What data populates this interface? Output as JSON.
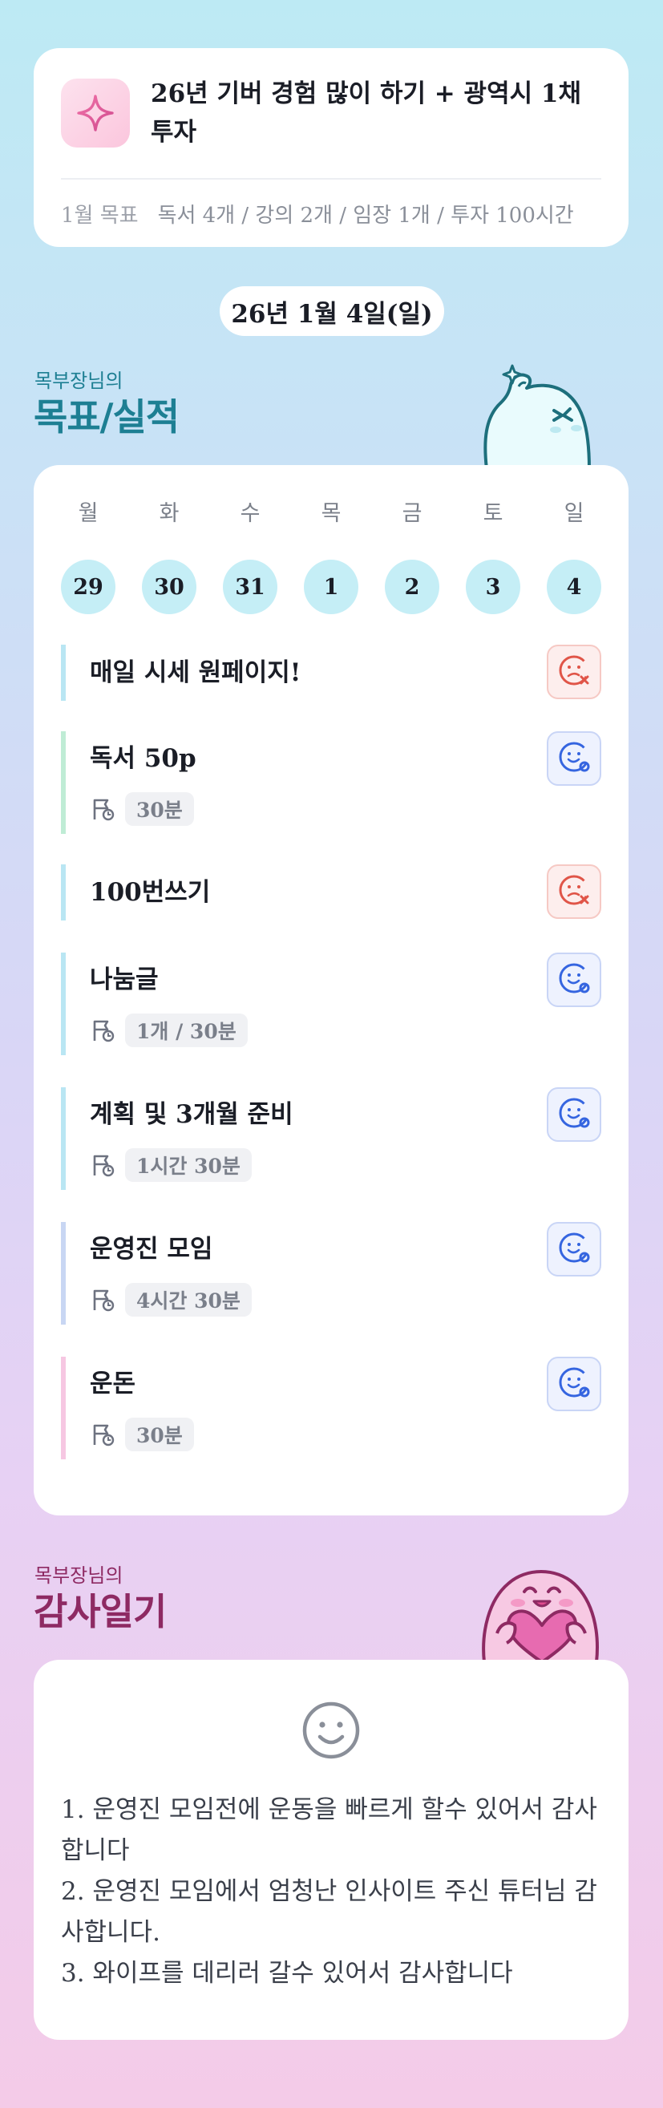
{
  "goal": {
    "icon": "sparkle-icon",
    "title": "26년 기버 경험 많이 하기 + 광역시 1채 투자",
    "month_label": "1월 목표",
    "month_goals": "독서 4개 / 강의 2개 / 임장 1개 / 투자 100시간"
  },
  "date": "26년 1월 4일(일)",
  "goals_section": {
    "owner": "목부장님의",
    "title": "목표/실적"
  },
  "week": {
    "days": [
      {
        "name": "월",
        "num": "29"
      },
      {
        "name": "화",
        "num": "30"
      },
      {
        "name": "수",
        "num": "31"
      },
      {
        "name": "목",
        "num": "1"
      },
      {
        "name": "금",
        "num": "2"
      },
      {
        "name": "토",
        "num": "3"
      },
      {
        "name": "일",
        "num": "4"
      }
    ]
  },
  "tasks": [
    {
      "name": "매일 시세 원페이지!",
      "time": "",
      "status": "fail",
      "bar_color": "#b9e6f3"
    },
    {
      "name": "독서 50p",
      "time": "30분",
      "status": "done",
      "bar_color": "#bfecd5"
    },
    {
      "name": "100번쓰기",
      "time": "",
      "status": "fail",
      "bar_color": "#b9e6f3"
    },
    {
      "name": "나눔글",
      "time": "1개 / 30분",
      "status": "done",
      "bar_color": "#b9e6f3"
    },
    {
      "name": "계획 및 3개월 준비",
      "time": "1시간 30분",
      "status": "done",
      "bar_color": "#b9e6f3"
    },
    {
      "name": "운영진 모임",
      "time": "4시간 30분",
      "status": "done",
      "bar_color": "#c8d6f3"
    },
    {
      "name": "운돈",
      "time": "30분",
      "status": "done",
      "bar_color": "#f6c7e2"
    }
  ],
  "thanks_section": {
    "owner": "목부장님의",
    "title": "감사일기"
  },
  "thanks": {
    "icon": "smiley-icon",
    "lines": [
      "1. 운영진 모임전에 운동을 빠르게 할수 있어서 감사합니다",
      "2. 운영진 모임에서 엄청난 인사이트 주신 튜터님 감사합니다.",
      "3. 와이프를 데리러 갈수 있어서 감사합니다"
    ]
  },
  "colors": {
    "accent_teal": "#1d7f93",
    "accent_plum": "#8e2a63",
    "fail_red": "#e05548",
    "done_blue": "#3565e0"
  }
}
